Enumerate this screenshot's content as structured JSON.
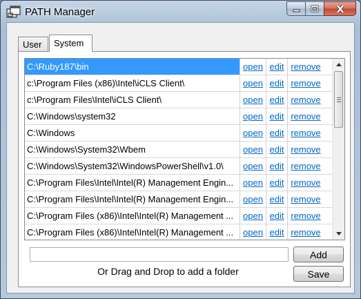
{
  "window": {
    "title": "PATH Manager",
    "icon": "app-window-icon",
    "buttons": [
      "minimize",
      "maximize",
      "close"
    ]
  },
  "tabs": [
    {
      "label": "User",
      "active": false
    },
    {
      "label": "System",
      "active": true
    }
  ],
  "path_list": {
    "rows": [
      {
        "path": "C:\\Ruby187\\bin",
        "open": "open",
        "edit": "edit",
        "remove": "remove",
        "selected": true
      },
      {
        "path": "c:\\Program Files (x86)\\Intel\\iCLS Client\\",
        "open": "open",
        "edit": "edit",
        "remove": "remove",
        "selected": false
      },
      {
        "path": "c:\\Program Files\\Intel\\iCLS Client\\",
        "open": "open",
        "edit": "edit",
        "remove": "remove",
        "selected": false
      },
      {
        "path": "C:\\Windows\\system32",
        "open": "open",
        "edit": "edit",
        "remove": "remove",
        "selected": false
      },
      {
        "path": "C:\\Windows",
        "open": "open",
        "edit": "edit",
        "remove": "remove",
        "selected": false
      },
      {
        "path": "C:\\Windows\\System32\\Wbem",
        "open": "open",
        "edit": "edit",
        "remove": "remove",
        "selected": false
      },
      {
        "path": "C:\\Windows\\System32\\WindowsPowerShell\\v1.0\\",
        "open": "open",
        "edit": "edit",
        "remove": "remove",
        "selected": false
      },
      {
        "path": "C:\\Program Files\\Intel\\Intel(R) Management Engin...",
        "open": "open",
        "edit": "edit",
        "remove": "remove",
        "selected": false
      },
      {
        "path": "C:\\Program Files\\Intel\\Intel(R) Management Engin...",
        "open": "open",
        "edit": "edit",
        "remove": "remove",
        "selected": false
      },
      {
        "path": "C:\\Program Files (x86)\\Intel\\Intel(R) Management ...",
        "open": "open",
        "edit": "edit",
        "remove": "remove",
        "selected": false
      },
      {
        "path": "C:\\Program Files (x86)\\Intel\\Intel(R) Management ...",
        "open": "open",
        "edit": "edit",
        "remove": "remove",
        "selected": false
      }
    ],
    "selected_color": "#3399ff",
    "link_color": "#0066cc"
  },
  "add_field": {
    "value": "",
    "placeholder": ""
  },
  "add_button": "Add",
  "save_button": "Save",
  "hint": "Or Drag and Drop to add a folder"
}
